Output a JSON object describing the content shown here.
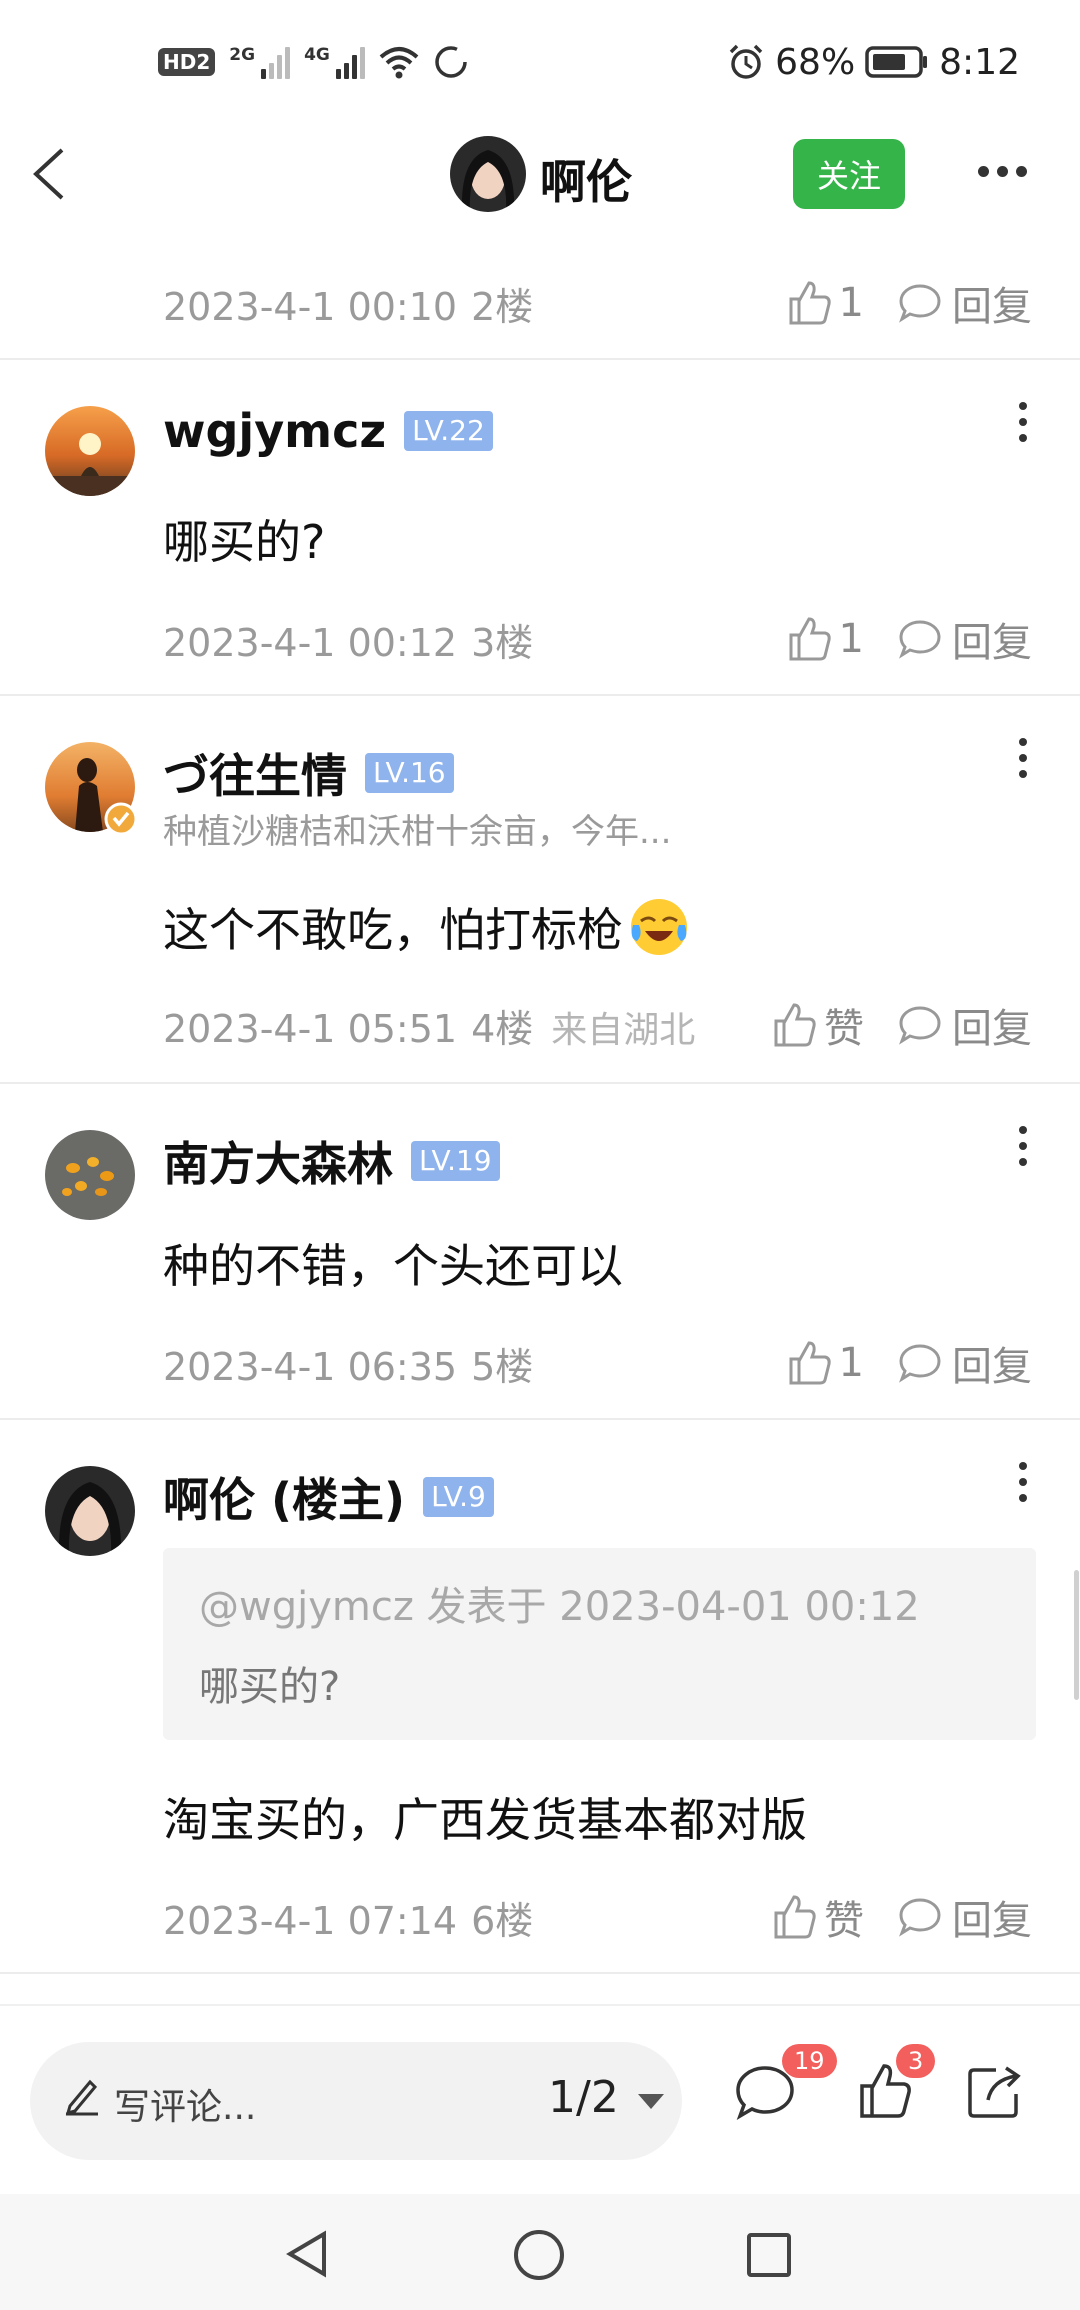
{
  "status_bar": {
    "hd_label": "HD",
    "hd_sub": "2",
    "signal1": "2G",
    "signal2": "4G",
    "battery": "68%",
    "time": "8:12"
  },
  "header": {
    "title": "啊伦",
    "follow_label": "关注"
  },
  "posts": [
    {
      "timestamp": "2023-4-1 00:10",
      "floor": "2楼",
      "like_count": "1",
      "reply_label": "回复"
    },
    {
      "user": "wgjymcz",
      "level": "LV.22",
      "content": "哪买的?",
      "timestamp": "2023-4-1 00:12",
      "floor": "3楼",
      "like_count": "1",
      "reply_label": "回复"
    },
    {
      "user": "づ往生情",
      "level": "LV.16",
      "bio": "种植沙糖桔和沃柑十余亩，今年...",
      "content": "这个不敢吃，怕打标枪",
      "timestamp": "2023-4-1 05:51",
      "floor": "4楼",
      "location": "来自湖北",
      "like_count": "赞",
      "reply_label": "回复"
    },
    {
      "user": "南方大森林",
      "level": "LV.19",
      "content": "种的不错，个头还可以",
      "timestamp": "2023-4-1 06:35",
      "floor": "5楼",
      "like_count": "1",
      "reply_label": "回复"
    },
    {
      "user": "啊伦 (楼主)",
      "level": "LV.9",
      "quote_header": "@wgjymcz 发表于 2023-04-01 00:12",
      "quote_text": "哪买的?",
      "content": "淘宝买的，广西发货基本都对版",
      "timestamp": "2023-4-1 07:14",
      "floor": "6楼",
      "like_count": "赞",
      "reply_label": "回复"
    }
  ],
  "bottom_bar": {
    "comment_placeholder": "写评论...",
    "page_indicator": "1/2",
    "comment_badge": "19",
    "like_badge": "3"
  },
  "colors": {
    "accent_green": "#35b44a",
    "level_badge": "#8fb3ec",
    "notification_red": "#f25f5c"
  }
}
